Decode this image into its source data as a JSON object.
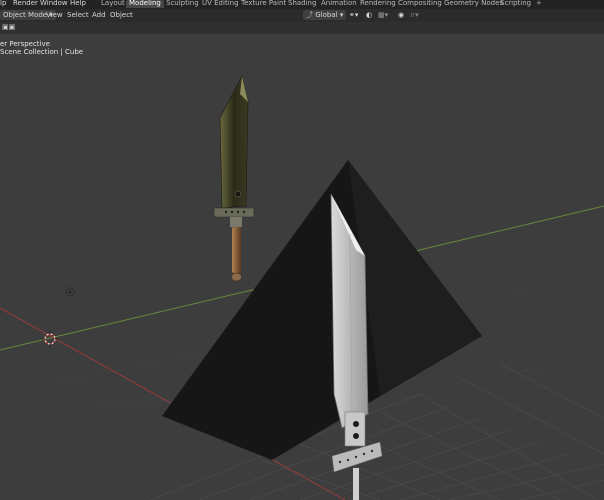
{
  "menu": [
    "lp",
    "Render",
    "Window",
    "Help"
  ],
  "workspaces": [
    "Layout",
    "Modeling",
    "Sculpting",
    "UV Editing",
    "Texture Paint",
    "Shading",
    "Animation",
    "Rendering",
    "Compositing",
    "Geometry Nodes",
    "Scripting"
  ],
  "active_workspace": "Modeling",
  "header": {
    "mode": "Object Mode",
    "menus": [
      "View",
      "Select",
      "Add",
      "Object"
    ],
    "orientation": "Global"
  },
  "viewport": {
    "view_name": "er Perspective",
    "collection": "Scene Collection | Cube"
  },
  "icons": [
    "chevron-down-icon",
    "transform-pivot-icon",
    "snap-icon",
    "proportional-edit-icon",
    "tool-icon",
    "camera-icon",
    "light-icon",
    "cursor-icon"
  ],
  "colors": {
    "background": "#3d3d3d",
    "topbar": "#232323",
    "grid": "#454545",
    "x_axis": "#9a3a3a",
    "y_axis": "#6a8a3a"
  }
}
